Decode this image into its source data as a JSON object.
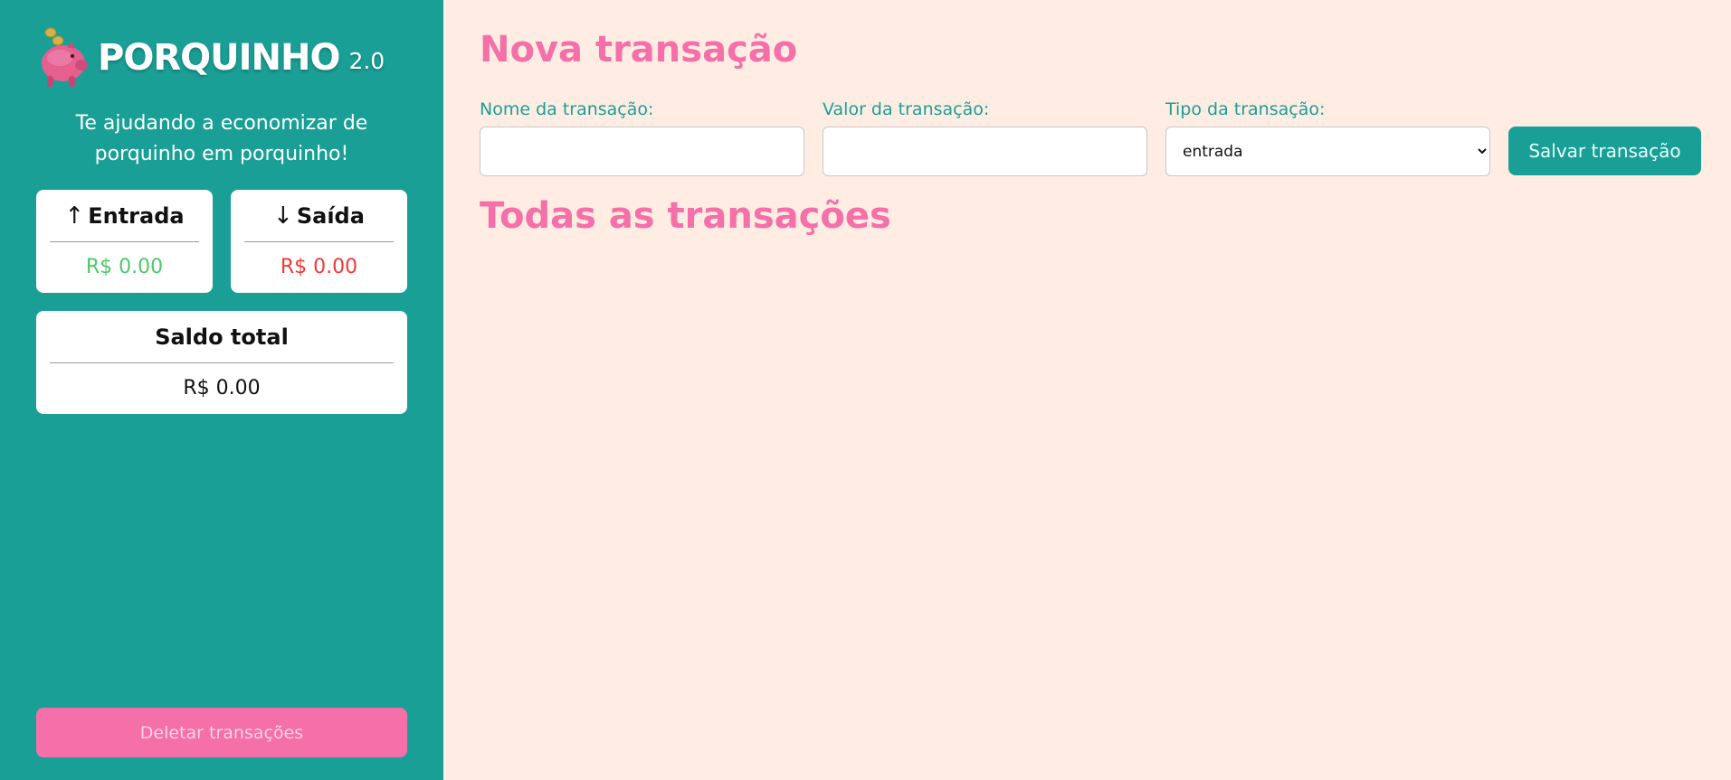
{
  "brand": {
    "title": "PORQUINHO",
    "version": "2.0",
    "logo_icon": "piggy-bank-icon"
  },
  "sidebar": {
    "tagline": "Te ajudando a economizar de porquinho em porquinho!",
    "cards": {
      "entrada": {
        "label": "Entrada",
        "value": "R$ 0.00",
        "icon": "arrow-up-icon",
        "color": "#4ec86b"
      },
      "saida": {
        "label": "Saída",
        "value": "R$ 0.00",
        "icon": "arrow-down-icon",
        "color": "#ef3a37"
      },
      "total": {
        "label": "Saldo total",
        "value": "R$ 0.00"
      }
    },
    "delete_button": "Deletar transações"
  },
  "main": {
    "new_title": "Nova transação",
    "form": {
      "name_label": "Nome da transação:",
      "name_value": "",
      "value_label": "Valor da transação:",
      "value_value": "",
      "type_label": "Tipo da transação:",
      "type_selected": "entrada",
      "save_button": "Salvar transação"
    },
    "all_title": "Todas as transações"
  },
  "colors": {
    "sidebar_bg": "#1a9f96",
    "main_bg": "#ffede3",
    "accent_pink": "#f56fa8"
  }
}
